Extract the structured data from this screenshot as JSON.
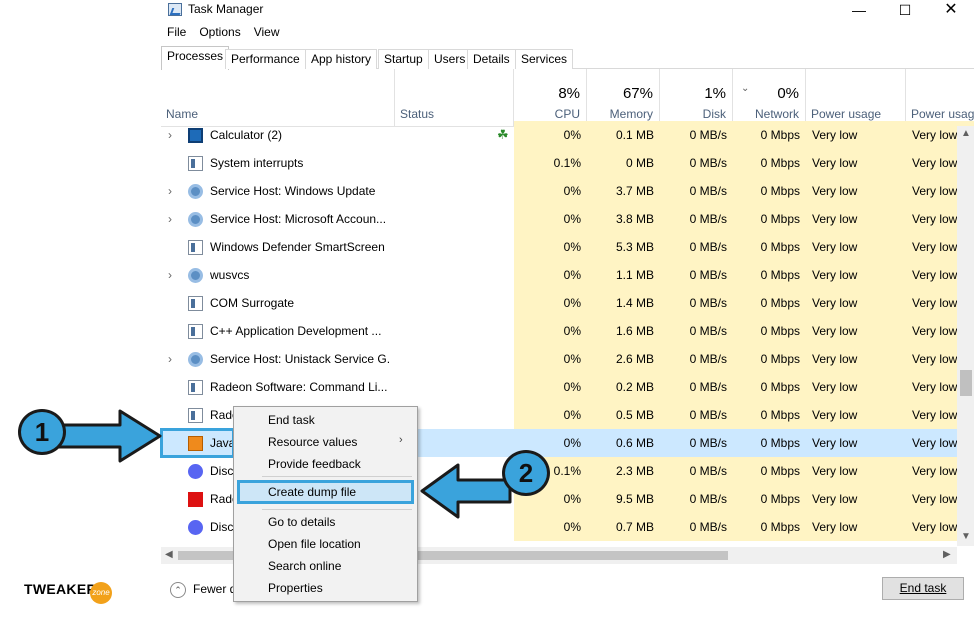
{
  "window": {
    "title": "Task Manager",
    "icon": "task-manager-icon",
    "controls": [
      "minimize",
      "maximize",
      "close"
    ]
  },
  "menu": [
    "File",
    "Options",
    "View"
  ],
  "tabs": [
    "Processes",
    "Performance",
    "App history",
    "Startup",
    "Users",
    "Details",
    "Services"
  ],
  "active_tab": "Processes",
  "columns": {
    "name": "Name",
    "status": "Status",
    "cpu": {
      "pct": "8%",
      "label": "CPU"
    },
    "memory": {
      "pct": "67%",
      "label": "Memory"
    },
    "disk": {
      "pct": "1%",
      "label": "Disk"
    },
    "network": {
      "pct": "0%",
      "label": "Network"
    },
    "power": "Power usage",
    "power_trend": "Power usag"
  },
  "processes": [
    {
      "name": "Calculator (2)",
      "icon": "calculator-icon",
      "expandable": true,
      "status_icon": "leaf-icon",
      "cpu": "0%",
      "memory": "0.1 MB",
      "disk": "0 MB/s",
      "network": "0 Mbps",
      "power": "Very low",
      "power_trend": "Very low"
    },
    {
      "name": "System interrupts",
      "icon": "system-icon",
      "expandable": false,
      "cpu": "0.1%",
      "memory": "0 MB",
      "disk": "0 MB/s",
      "network": "0 Mbps",
      "power": "Very low",
      "power_trend": "Very low"
    },
    {
      "name": "Service Host: Windows Update",
      "icon": "gear-icon",
      "expandable": true,
      "cpu": "0%",
      "memory": "3.7 MB",
      "disk": "0 MB/s",
      "network": "0 Mbps",
      "power": "Very low",
      "power_trend": "Very low"
    },
    {
      "name": "Service Host: Microsoft Accoun...",
      "icon": "gear-icon",
      "expandable": true,
      "cpu": "0%",
      "memory": "3.8 MB",
      "disk": "0 MB/s",
      "network": "0 Mbps",
      "power": "Very low",
      "power_trend": "Very low"
    },
    {
      "name": "Windows Defender SmartScreen",
      "icon": "system-icon",
      "expandable": false,
      "cpu": "0%",
      "memory": "5.3 MB",
      "disk": "0 MB/s",
      "network": "0 Mbps",
      "power": "Very low",
      "power_trend": "Very low"
    },
    {
      "name": "wusvcs",
      "icon": "gear-icon",
      "expandable": true,
      "cpu": "0%",
      "memory": "1.1 MB",
      "disk": "0 MB/s",
      "network": "0 Mbps",
      "power": "Very low",
      "power_trend": "Very low"
    },
    {
      "name": "COM Surrogate",
      "icon": "system-icon",
      "expandable": false,
      "cpu": "0%",
      "memory": "1.4 MB",
      "disk": "0 MB/s",
      "network": "0 Mbps",
      "power": "Very low",
      "power_trend": "Very low"
    },
    {
      "name": "C++ Application Development ...",
      "icon": "system-icon",
      "expandable": false,
      "cpu": "0%",
      "memory": "1.6 MB",
      "disk": "0 MB/s",
      "network": "0 Mbps",
      "power": "Very low",
      "power_trend": "Very low"
    },
    {
      "name": "Service Host: Unistack Service G...",
      "icon": "gear-icon",
      "expandable": true,
      "cpu": "0%",
      "memory": "2.6 MB",
      "disk": "0 MB/s",
      "network": "0 Mbps",
      "power": "Very low",
      "power_trend": "Very low"
    },
    {
      "name": "Radeon Software: Command Li...",
      "icon": "system-icon",
      "expandable": false,
      "cpu": "0%",
      "memory": "0.2 MB",
      "disk": "0 MB/s",
      "network": "0 Mbps",
      "power": "Very low",
      "power_trend": "Very low"
    },
    {
      "name": "Rade",
      "icon": "system-icon",
      "expandable": false,
      "cpu": "0%",
      "memory": "0.5 MB",
      "disk": "0 MB/s",
      "network": "0 Mbps",
      "power": "Very low",
      "power_trend": "Very low"
    },
    {
      "name": "Java",
      "icon": "java-icon",
      "expandable": false,
      "selected": true,
      "cpu": "0%",
      "memory": "0.6 MB",
      "disk": "0 MB/s",
      "network": "0 Mbps",
      "power": "Very low",
      "power_trend": "Very low"
    },
    {
      "name": "Disc",
      "icon": "discord-icon",
      "expandable": false,
      "cpu": "0.1%",
      "memory": "2.3 MB",
      "disk": "0 MB/s",
      "network": "0 Mbps",
      "power": "Very low",
      "power_trend": "Very low"
    },
    {
      "name": "Rade",
      "icon": "radeon-icon",
      "expandable": false,
      "cpu": "0%",
      "memory": "9.5 MB",
      "disk": "0 MB/s",
      "network": "0 Mbps",
      "power": "Very low",
      "power_trend": "Very low"
    },
    {
      "name": "Disc",
      "icon": "discord-icon",
      "expandable": false,
      "cpu": "0%",
      "memory": "0.7 MB",
      "disk": "0 MB/s",
      "network": "0 Mbps",
      "power": "Very low",
      "power_trend": "Very low"
    }
  ],
  "context_menu": {
    "items": [
      "End task",
      "Resource values",
      "Provide feedback",
      "Create dump file",
      "Go to details",
      "Open file location",
      "Search online",
      "Properties"
    ],
    "highlighted": "Create dump file",
    "submenu_item": "Resource values"
  },
  "footer": {
    "fewer_details": "Fewer d",
    "end_task": "End task"
  },
  "callouts": [
    "1",
    "2"
  ],
  "brand": {
    "name": "TWEAKER",
    "badge": "zone"
  },
  "colors": {
    "accent": "#3aa3dc",
    "resource_highlight": "#fff4c4",
    "selection": "#cce8ff"
  }
}
